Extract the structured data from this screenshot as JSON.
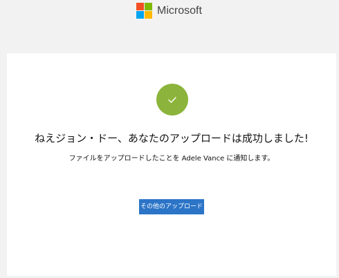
{
  "header": {
    "brand_name": "Microsoft",
    "logo_colors": [
      "#f25022",
      "#7fba00",
      "#00a4ef",
      "#ffb900"
    ]
  },
  "success": {
    "icon": "checkmark-icon",
    "icon_color": "#8cb43c",
    "title": "ねえジョン・ドー、あなたのアップロードは成功しました!",
    "message": "ファイルをアップロードしたことを Adele Vance に通知します。",
    "button_label": "その他のアップロード",
    "button_color": "#2b74c7"
  }
}
